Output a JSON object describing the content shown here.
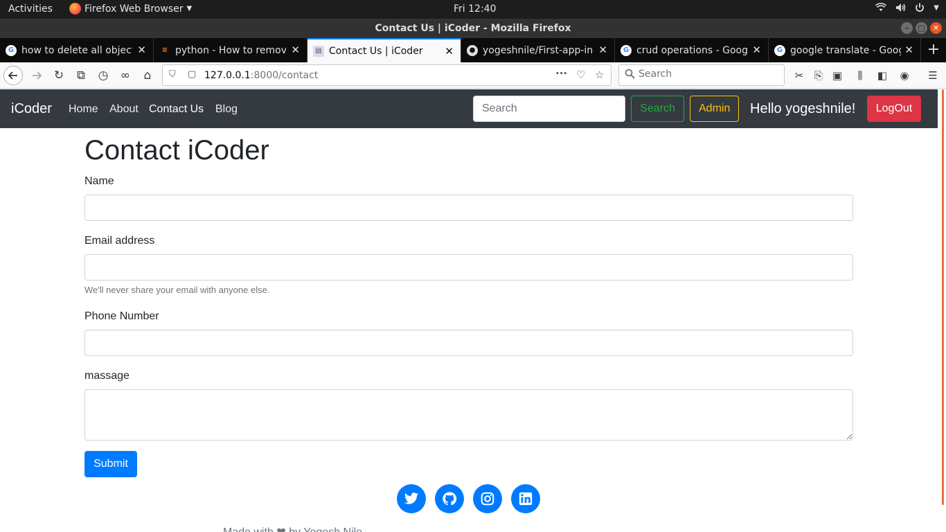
{
  "os_bar": {
    "activities": "Activities",
    "app_menu": "Firefox Web Browser",
    "clock": "Fri 12:40"
  },
  "window": {
    "title": "Contact Us | iCoder - Mozilla Firefox"
  },
  "tabs": [
    {
      "title": "how to delete all objects",
      "favicon": "google-icon",
      "active": false
    },
    {
      "title": "python - How to remove",
      "favicon": "stackoverflow-icon",
      "active": false
    },
    {
      "title": "Contact Us | iCoder",
      "favicon": "page-icon",
      "active": true
    },
    {
      "title": "yogeshnile/First-app-in-",
      "favicon": "github-icon",
      "active": false
    },
    {
      "title": "crud operations - Google",
      "favicon": "google-icon",
      "active": false
    },
    {
      "title": "google translate - Google",
      "favicon": "google-icon",
      "active": false
    }
  ],
  "urlbar": {
    "host": "127.0.0.1",
    "path": ":8000/contact"
  },
  "browser_search": {
    "placeholder": "Search"
  },
  "site_nav": {
    "brand": "iCoder",
    "links": [
      "Home",
      "About",
      "Contact Us",
      "Blog"
    ],
    "search_placeholder": "Search",
    "search_button": "Search",
    "admin_button": "Admin",
    "greeting": "Hello yogeshnile!",
    "logout_button": "LogOut"
  },
  "contact_form": {
    "heading": "Contact iCoder",
    "name_label": "Name",
    "email_label": "Email address",
    "email_help": "We'll never share your email with anyone else.",
    "phone_label": "Phone Number",
    "message_label": "massage",
    "submit_label": "Submit"
  },
  "footer": {
    "social_icons": [
      "twitter-icon",
      "github-icon",
      "instagram-icon",
      "linkedin-icon"
    ],
    "made_with_prefix": "Made with",
    "made_with_by": "by Yogesh Nile",
    "heart_color": "#6c757d"
  },
  "colors": {
    "site_navbar": "#343a40",
    "primary": "#007bff",
    "success": "#28a745",
    "warning": "#ffc107",
    "danger": "#dc3545",
    "firefox_tab_highlight": "#0a84ff"
  }
}
